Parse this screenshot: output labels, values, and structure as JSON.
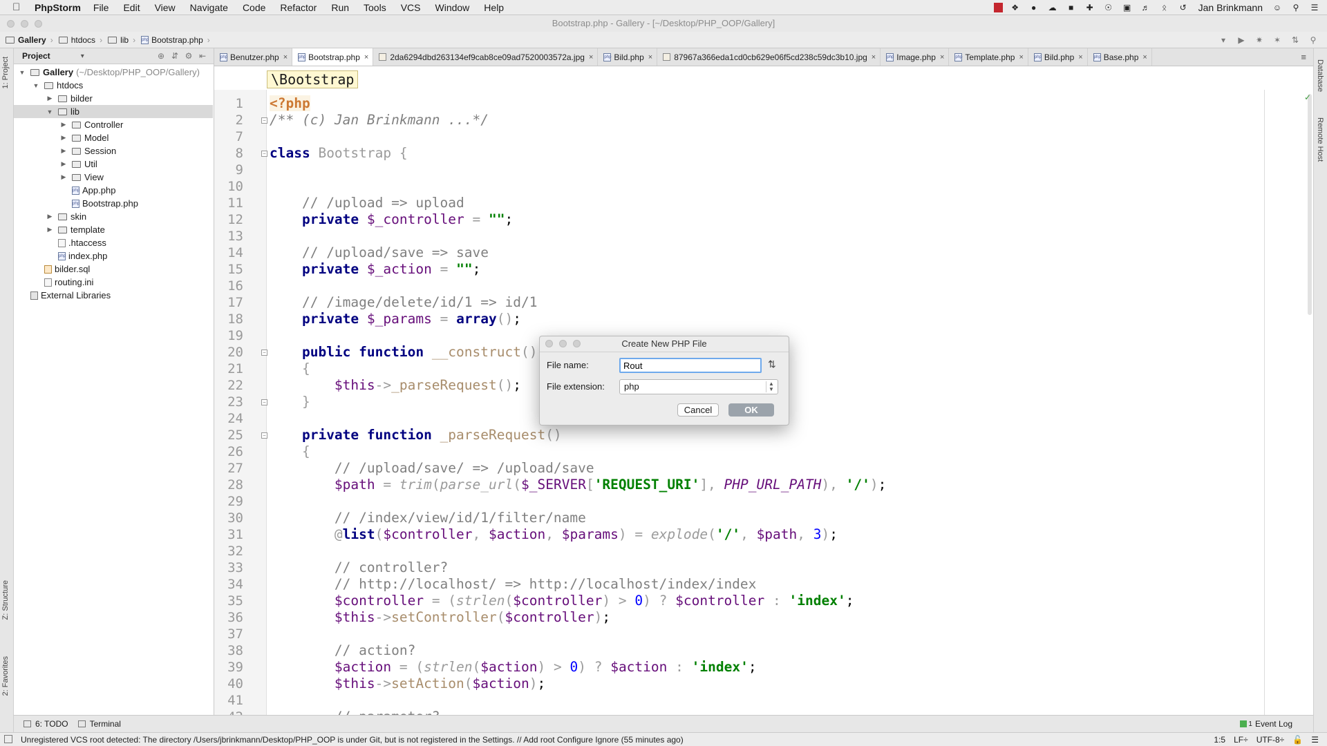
{
  "menubar": {
    "app": "PhpStorm",
    "items": [
      "File",
      "Edit",
      "View",
      "Navigate",
      "Code",
      "Refactor",
      "Run",
      "Tools",
      "VCS",
      "Window",
      "Help"
    ],
    "user": "Jan Brinkmann"
  },
  "window": {
    "title": "Bootstrap.php - Gallery - [~/Desktop/PHP_OOP/Gallery]"
  },
  "navbar": {
    "crumbs": [
      "Gallery",
      "htdocs",
      "lib",
      "Bootstrap.php"
    ]
  },
  "sidestripes": {
    "left_top": "1: Project",
    "left_mid": "Z: Structure",
    "left_bottom": "2: Favorites",
    "right_top": "Database",
    "right_mid": "Remote Host"
  },
  "project": {
    "header": "Project",
    "tree": [
      {
        "label": "Gallery",
        "hint": "(~/Desktop/PHP_OOP/Gallery)",
        "depth": 0,
        "type": "folder",
        "open": true
      },
      {
        "label": "htdocs",
        "depth": 1,
        "type": "folder",
        "open": true
      },
      {
        "label": "bilder",
        "depth": 2,
        "type": "folder",
        "open": false
      },
      {
        "label": "lib",
        "depth": 2,
        "type": "folder",
        "open": true,
        "selected": true
      },
      {
        "label": "Controller",
        "depth": 3,
        "type": "folder",
        "open": false
      },
      {
        "label": "Model",
        "depth": 3,
        "type": "folder",
        "open": false
      },
      {
        "label": "Session",
        "depth": 3,
        "type": "folder",
        "open": false
      },
      {
        "label": "Util",
        "depth": 3,
        "type": "folder",
        "open": false
      },
      {
        "label": "View",
        "depth": 3,
        "type": "folder",
        "open": false
      },
      {
        "label": "App.php",
        "depth": 3,
        "type": "php"
      },
      {
        "label": "Bootstrap.php",
        "depth": 3,
        "type": "php"
      },
      {
        "label": "skin",
        "depth": 2,
        "type": "folder",
        "open": false
      },
      {
        "label": "template",
        "depth": 2,
        "type": "folder",
        "open": false
      },
      {
        "label": ".htaccess",
        "depth": 2,
        "type": "file"
      },
      {
        "label": "index.php",
        "depth": 2,
        "type": "php"
      },
      {
        "label": "bilder.sql",
        "depth": 1,
        "type": "sql"
      },
      {
        "label": "routing.ini",
        "depth": 1,
        "type": "file"
      },
      {
        "label": "External Libraries",
        "depth": 0,
        "type": "lib"
      }
    ]
  },
  "tabs": [
    {
      "label": "Benutzer.php",
      "type": "php"
    },
    {
      "label": "Bootstrap.php",
      "type": "php",
      "active": true
    },
    {
      "label": "2da6294dbd263134ef9cab8ce09ad7520003572a.jpg",
      "type": "img"
    },
    {
      "label": "Bild.php",
      "type": "php"
    },
    {
      "label": "87967a366eda1cd0cb629e06f5cd238c59dc3b10.jpg",
      "type": "img"
    },
    {
      "label": "Image.php",
      "type": "php"
    },
    {
      "label": "Template.php",
      "type": "php"
    },
    {
      "label": "Bild.php",
      "type": "php"
    },
    {
      "label": "Base.php",
      "type": "php"
    }
  ],
  "editor": {
    "breadcrumb": "\\Bootstrap",
    "lines": [
      {
        "n": "1",
        "html": "<span class=\"php-tag\">&lt;?php</span>"
      },
      {
        "n": "2",
        "html": "<span class=\"cm\">/** (c) Jan Brinkmann ...*/</span>",
        "fold": true
      },
      {
        "n": "7",
        "html": ""
      },
      {
        "n": "8",
        "html": "<span class=\"kw\">class</span> <span class=\"cls\">Bootstrap {</span>",
        "fold": true
      },
      {
        "n": "9",
        "html": ""
      },
      {
        "n": "10",
        "html": ""
      },
      {
        "n": "11",
        "html": "    <span class=\"cmn\">// /upload =&gt; upload</span>"
      },
      {
        "n": "12",
        "html": "    <span class=\"kw\">private</span> <span class=\"var\">$_controller</span> <span class=\"punc\">=</span> <span class=\"str\">\"\"</span>;"
      },
      {
        "n": "13",
        "html": ""
      },
      {
        "n": "14",
        "html": "    <span class=\"cmn\">// /upload/save =&gt; save</span>"
      },
      {
        "n": "15",
        "html": "    <span class=\"kw\">private</span> <span class=\"var\">$_action</span> <span class=\"punc\">=</span> <span class=\"str\">\"\"</span>;"
      },
      {
        "n": "16",
        "html": ""
      },
      {
        "n": "17",
        "html": "    <span class=\"cmn\">// /image/delete/id/1 =&gt; id/1</span>"
      },
      {
        "n": "18",
        "html": "    <span class=\"kw\">private</span> <span class=\"var\">$_params</span> <span class=\"punc\">=</span> <span class=\"kw\">array</span><span class=\"punc\">()</span>;"
      },
      {
        "n": "19",
        "html": ""
      },
      {
        "n": "20",
        "html": "    <span class=\"kw\">public function</span> <span class=\"fn\">__construct</span><span class=\"punc\">()</span>",
        "fold": true
      },
      {
        "n": "21",
        "html": "    <span class=\"punc\">{</span>"
      },
      {
        "n": "22",
        "html": "        <span class=\"var\">$this</span><span class=\"punc\">-&gt;</span><span class=\"fn\">_parseRequest</span><span class=\"punc\">()</span>;"
      },
      {
        "n": "23",
        "html": "    <span class=\"punc\">}</span>",
        "fold": true
      },
      {
        "n": "24",
        "html": ""
      },
      {
        "n": "25",
        "html": "    <span class=\"kw\">private function</span> <span class=\"fn\">_parseRequest</span><span class=\"punc\">()</span>",
        "fold": true
      },
      {
        "n": "26",
        "html": "    <span class=\"punc\">{</span>"
      },
      {
        "n": "27",
        "html": "        <span class=\"cmn\">// /upload/save/ =&gt; /upload/save</span>"
      },
      {
        "n": "28",
        "html": "        <span class=\"var\">$path</span> <span class=\"punc\">=</span> <span class=\"fnc\">trim</span><span class=\"punc\">(</span><span class=\"fnc\">parse_url</span><span class=\"punc\">(</span><span class=\"var\">$_SERVER</span><span class=\"punc\">[</span><span class=\"str\">'REQUEST_URI'</span><span class=\"punc\">],</span> <span class=\"const\">PHP_URL_PATH</span><span class=\"punc\">),</span> <span class=\"str\">'/'</span><span class=\"punc\">)</span>;"
      },
      {
        "n": "29",
        "html": ""
      },
      {
        "n": "30",
        "html": "        <span class=\"cmn\">// /index/view/id/1/filter/name</span>"
      },
      {
        "n": "31",
        "html": "        <span class=\"punc\">@</span><span class=\"kw\">list</span><span class=\"punc\">(</span><span class=\"var\">$controller</span><span class=\"punc\">,</span> <span class=\"var\">$action</span><span class=\"punc\">,</span> <span class=\"var\">$params</span><span class=\"punc\">) =</span> <span class=\"fnc\">explode</span><span class=\"punc\">(</span><span class=\"str\">'/'</span><span class=\"punc\">,</span> <span class=\"var\">$path</span><span class=\"punc\">,</span> <span class=\"num\">3</span><span class=\"punc\">)</span>;"
      },
      {
        "n": "32",
        "html": ""
      },
      {
        "n": "33",
        "html": "        <span class=\"cmn\">// controller?</span>"
      },
      {
        "n": "34",
        "html": "        <span class=\"cmn\">// http://localhost/ =&gt; http://localhost/index/index</span>"
      },
      {
        "n": "35",
        "html": "        <span class=\"var\">$controller</span> <span class=\"punc\">= (</span><span class=\"fnc\">strlen</span><span class=\"punc\">(</span><span class=\"var\">$controller</span><span class=\"punc\">) &gt;</span> <span class=\"num\">0</span><span class=\"punc\">) ?</span> <span class=\"var\">$controller</span> <span class=\"punc\">:</span> <span class=\"str\">'index'</span>;"
      },
      {
        "n": "36",
        "html": "        <span class=\"var\">$this</span><span class=\"punc\">-&gt;</span><span class=\"fn\">setController</span><span class=\"punc\">(</span><span class=\"var\">$controller</span><span class=\"punc\">)</span>;"
      },
      {
        "n": "37",
        "html": ""
      },
      {
        "n": "38",
        "html": "        <span class=\"cmn\">// action?</span>"
      },
      {
        "n": "39",
        "html": "        <span class=\"var\">$action</span> <span class=\"punc\">= (</span><span class=\"fnc\">strlen</span><span class=\"punc\">(</span><span class=\"var\">$action</span><span class=\"punc\">) &gt;</span> <span class=\"num\">0</span><span class=\"punc\">) ?</span> <span class=\"var\">$action</span> <span class=\"punc\">:</span> <span class=\"str\">'index'</span>;"
      },
      {
        "n": "40",
        "html": "        <span class=\"var\">$this</span><span class=\"punc\">-&gt;</span><span class=\"fn\">setAction</span><span class=\"punc\">(</span><span class=\"var\">$action</span><span class=\"punc\">)</span>;"
      },
      {
        "n": "41",
        "html": ""
      },
      {
        "n": "42",
        "html": "        <span class=\"cmn\">// parameter?</span>"
      }
    ]
  },
  "toolwindows": {
    "todo": "6: TODO",
    "terminal": "Terminal",
    "eventlog": "Event Log",
    "eventlog_count": "1"
  },
  "statusbar": {
    "message": "Unregistered VCS root detected: The directory /Users/jbrinkmann/Desktop/PHP_OOP is under Git, but is not registered in the Settings. // Add root  Configure  Ignore (55 minutes ago)",
    "position": "1:5",
    "line_sep": "LF÷",
    "encoding": "UTF-8÷"
  },
  "dialog": {
    "title": "Create New PHP File",
    "file_name_label": "File name:",
    "file_name_value": "Rout",
    "file_ext_label": "File extension:",
    "file_ext_value": "php",
    "cancel": "Cancel",
    "ok": "OK"
  }
}
